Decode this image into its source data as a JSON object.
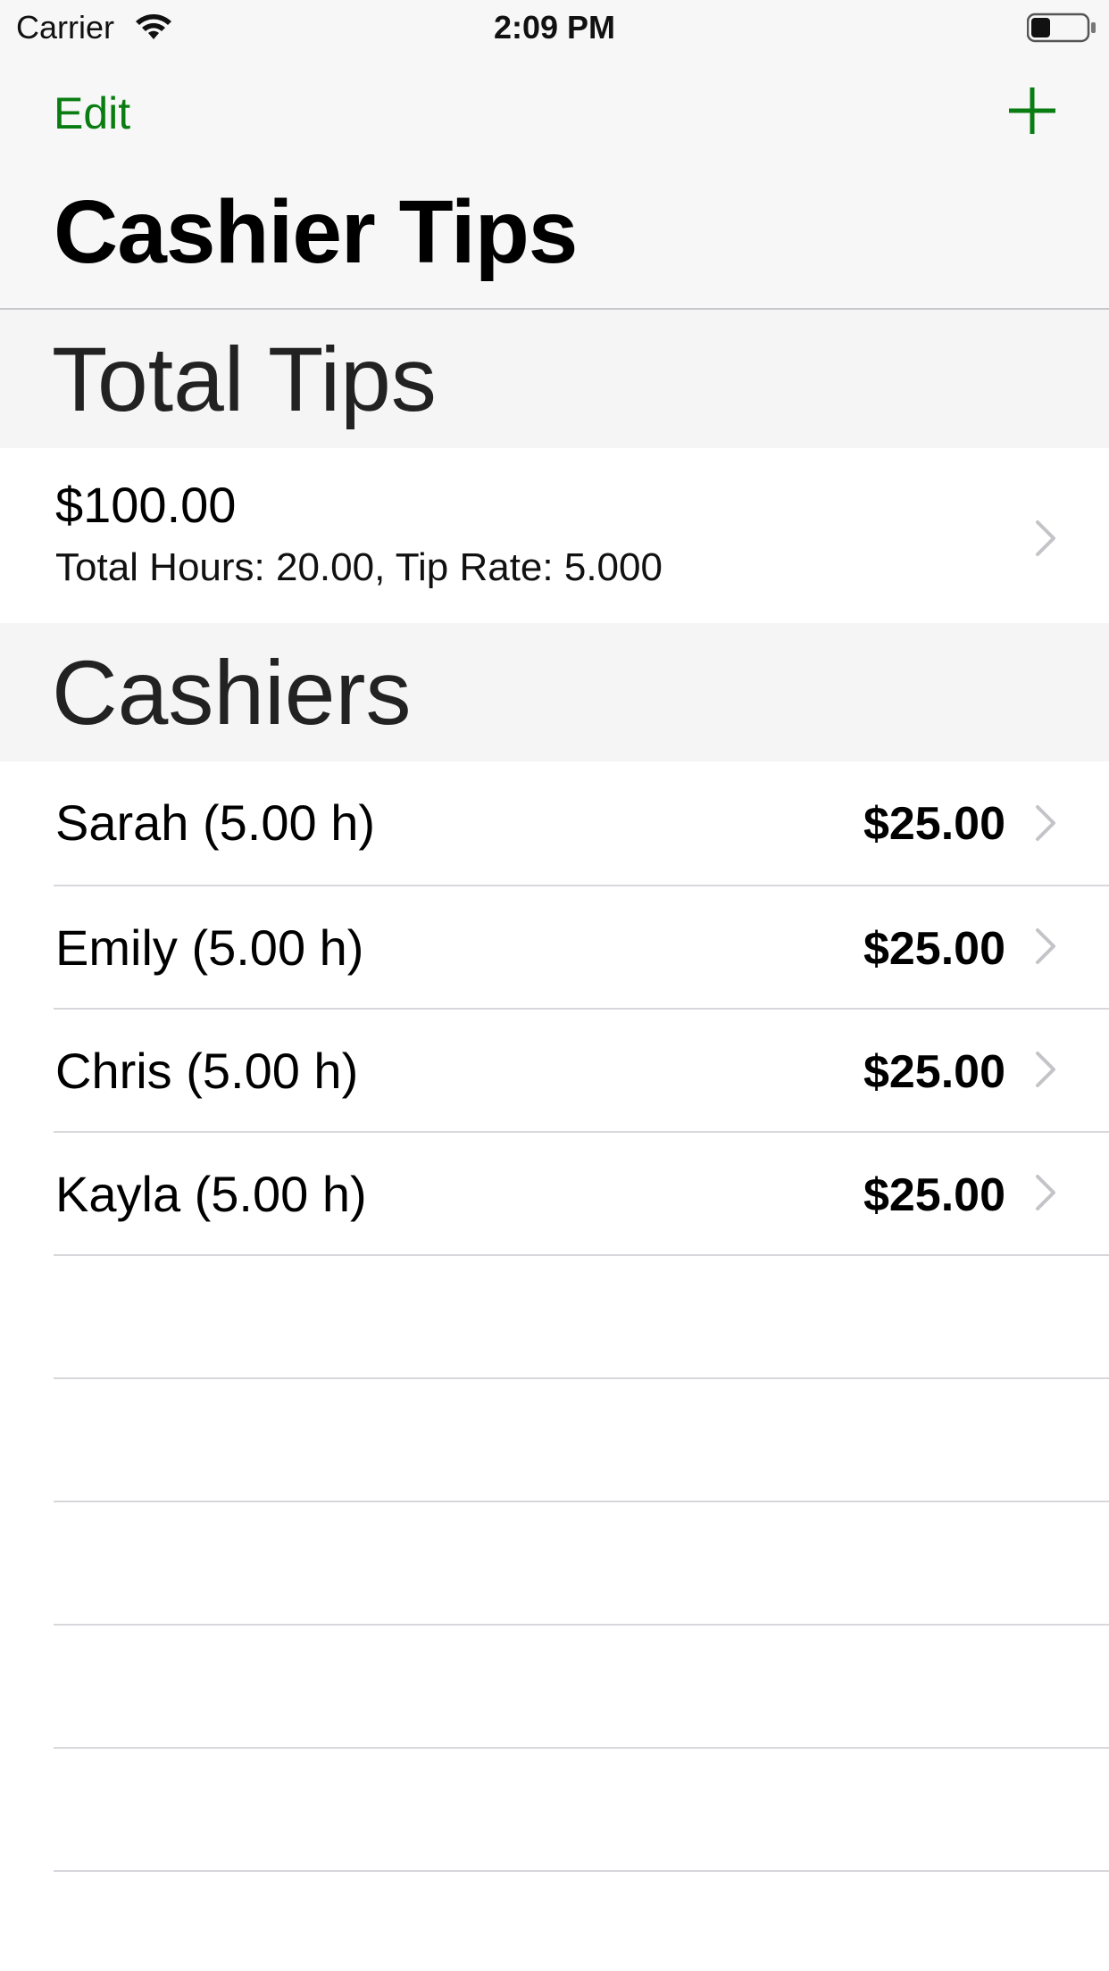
{
  "status_bar": {
    "carrier": "Carrier",
    "time": "2:09 PM",
    "wifi_icon": "wifi-icon",
    "battery_icon": "battery-icon",
    "battery_level": 0.35
  },
  "nav": {
    "edit_label": "Edit",
    "add_icon": "plus-icon",
    "title": "Cashier Tips",
    "accent_color": "#0a7d12"
  },
  "total_section": {
    "header": "Total Tips",
    "amount": "$100.00",
    "detail": "Total Hours: 20.00, Tip Rate: 5.000"
  },
  "cashiers_section": {
    "header": "Cashiers",
    "items": [
      {
        "name": "Sarah (5.00 h)",
        "amount": "$25.00"
      },
      {
        "name": "Emily (5.00 h)",
        "amount": "$25.00"
      },
      {
        "name": "Chris (5.00 h)",
        "amount": "$25.00"
      },
      {
        "name": "Kayla (5.00 h)",
        "amount": "$25.00"
      }
    ]
  }
}
